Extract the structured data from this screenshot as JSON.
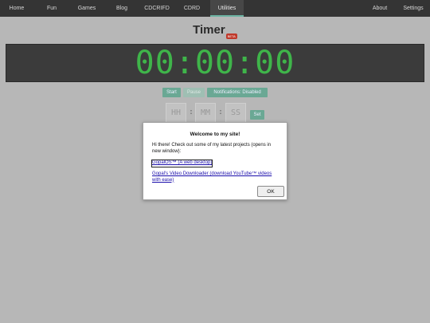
{
  "navbar": {
    "items": [
      {
        "label": "Home"
      },
      {
        "label": "Fun"
      },
      {
        "label": "Games"
      },
      {
        "label": "Blog"
      },
      {
        "label": "CDCRIFD"
      },
      {
        "label": "CDRD"
      },
      {
        "label": "Utilities",
        "active": true
      },
      {
        "label": "About"
      },
      {
        "label": "Settings"
      }
    ]
  },
  "page": {
    "title": "Timer",
    "badge": "BETA"
  },
  "timer": {
    "display": "00:00:00",
    "digit_color": "#3fb54a"
  },
  "controls": {
    "start_label": "Start",
    "pause_label": "Pause",
    "notifications_label": "Notifications: Disabled",
    "hours_placeholder": "HH",
    "minutes_placeholder": "MM",
    "seconds_placeholder": "SS",
    "separator": ":",
    "set_label": "Set"
  },
  "modal": {
    "title": "Welcome to my site!",
    "message": "Hi there! Check out some of my latest projects (opens in new window):",
    "links": [
      {
        "label": "GopalOS™ (A web desktop)"
      },
      {
        "label": "Gopal's Video Downloader (download YouTube™ videos with ease)"
      }
    ],
    "ok_label": "OK"
  },
  "colors": {
    "accent": "#6aa894",
    "navbar_bg": "#343434",
    "overlay_bg": "#b7b7b7"
  }
}
